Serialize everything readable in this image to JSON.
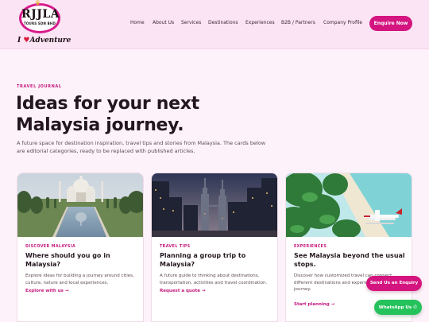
{
  "brand": {
    "logo_name": "RJJLA",
    "logo_subtitle": "TOURS SDN BHD",
    "tagline_prefix": "I",
    "tagline_suffix": "Adventure",
    "accent_color": "#d4147f"
  },
  "nav": {
    "items": [
      "Home",
      "About Us",
      "Services",
      "Destinations",
      "Experiences",
      "B2B / Partners",
      "Company Profile"
    ],
    "cta_label": "Enquire Now"
  },
  "hero": {
    "eyebrow": "TRAVEL JOURNAL",
    "title": "Ideas for your next Malaysia journey.",
    "description": "A future space for destination inspiration, travel tips and stories from Malaysia. The cards below are editorial categories, ready to be replaced with published articles."
  },
  "cards": [
    {
      "tag": "DISCOVER MALAYSIA",
      "title": "Where should you go in Malaysia?",
      "text": "Explore ideas for building a journey around cities, culture, nature and local experiences.",
      "link": "Explore with us →",
      "image": "palace-reflecting-pool"
    },
    {
      "tag": "TRAVEL TIPS",
      "title": "Planning a group trip to Malaysia?",
      "text": "A future guide to thinking about destinations, transportation, activities and travel coordination.",
      "link": "Request a quote →",
      "image": "city-skyline-towers"
    },
    {
      "tag": "EXPERIENCES",
      "title": "See Malaysia beyond the usual stops.",
      "text": "Discover how customized travel can connect different destinations and experiences into one journey.",
      "link": "Start planning →",
      "image": "seaplane-beach"
    }
  ],
  "floating": {
    "enquiry_label": "Send Us an Enquiry",
    "whatsapp_label": "WhatsApp Us"
  }
}
